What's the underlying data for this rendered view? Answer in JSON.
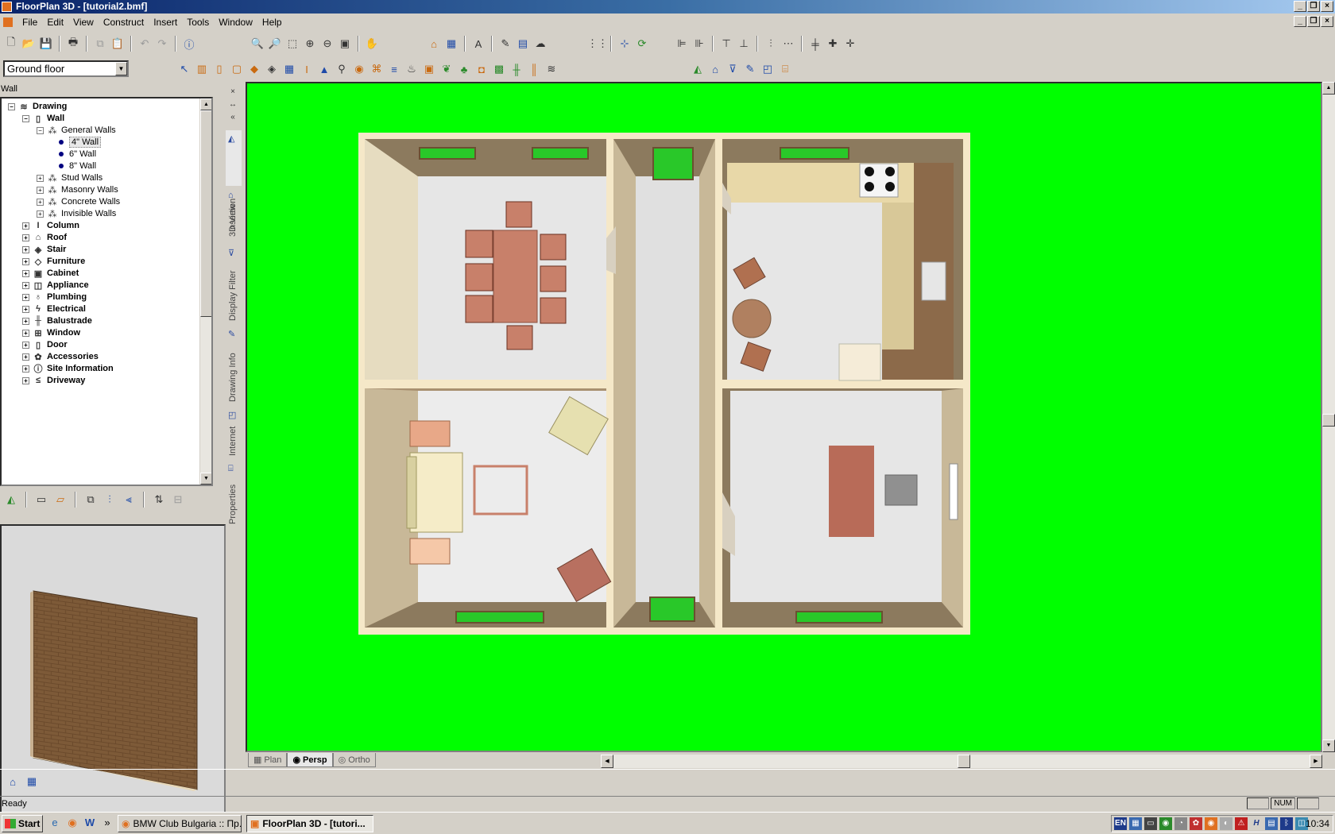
{
  "app": {
    "title": "FloorPlan 3D - [tutorial2.bmf]",
    "window_buttons": [
      "_",
      "❐",
      "×"
    ]
  },
  "menu": [
    "File",
    "Edit",
    "View",
    "Construct",
    "Insert",
    "Tools",
    "Window",
    "Help"
  ],
  "floor_select": {
    "value": "Ground floor"
  },
  "panel": {
    "title": "Wall",
    "tree": [
      {
        "label": "Drawing",
        "level": 0,
        "expander": "−",
        "bold": true,
        "icon": "≋"
      },
      {
        "label": "Wall",
        "level": 1,
        "expander": "−",
        "bold": true,
        "icon": "▯"
      },
      {
        "label": "General Walls",
        "level": 2,
        "expander": "−",
        "bold": false,
        "icon": "⁂"
      },
      {
        "label": "4\" Wall",
        "level": 3,
        "bullet": true,
        "selected": true
      },
      {
        "label": "6\" Wall",
        "level": 3,
        "bullet": true
      },
      {
        "label": "8\" Wall",
        "level": 3,
        "bullet": true
      },
      {
        "label": "Stud Walls",
        "level": 2,
        "expander": "+",
        "icon": "⁂"
      },
      {
        "label": "Masonry Walls",
        "level": 2,
        "expander": "+",
        "icon": "⁂"
      },
      {
        "label": "Concrete Walls",
        "level": 2,
        "expander": "+",
        "icon": "⁂"
      },
      {
        "label": "Invisible Walls",
        "level": 2,
        "expander": "+",
        "icon": "⁂"
      },
      {
        "label": "Column",
        "level": 1,
        "expander": "+",
        "bold": true,
        "icon": "I"
      },
      {
        "label": "Roof",
        "level": 1,
        "expander": "+",
        "bold": true,
        "icon": "⌂"
      },
      {
        "label": "Stair",
        "level": 1,
        "expander": "+",
        "bold": true,
        "icon": "◈"
      },
      {
        "label": "Furniture",
        "level": 1,
        "expander": "+",
        "bold": true,
        "icon": "◇"
      },
      {
        "label": "Cabinet",
        "level": 1,
        "expander": "+",
        "bold": true,
        "icon": "▣"
      },
      {
        "label": "Appliance",
        "level": 1,
        "expander": "+",
        "bold": true,
        "icon": "◫"
      },
      {
        "label": "Plumbing",
        "level": 1,
        "expander": "+",
        "bold": true,
        "icon": "♁"
      },
      {
        "label": "Electrical",
        "level": 1,
        "expander": "+",
        "bold": true,
        "icon": "ϟ"
      },
      {
        "label": "Balustrade",
        "level": 1,
        "expander": "+",
        "bold": true,
        "icon": "╫"
      },
      {
        "label": "Window",
        "level": 1,
        "expander": "+",
        "bold": true,
        "icon": "⊞"
      },
      {
        "label": "Door",
        "level": 1,
        "expander": "+",
        "bold": true,
        "icon": "▯"
      },
      {
        "label": "Accessories",
        "level": 1,
        "expander": "+",
        "bold": true,
        "icon": "✿"
      },
      {
        "label": "Site Information",
        "level": 1,
        "expander": "+",
        "bold": true,
        "icon": "ⓘ"
      },
      {
        "label": "Driveway",
        "level": 1,
        "expander": "+",
        "bold": true,
        "icon": "≤"
      }
    ]
  },
  "vertical_tabs": [
    "Insertion",
    "3D View",
    "Display Filter",
    "Drawing Info",
    "Internet",
    "Properties"
  ],
  "view_tabs": [
    {
      "label": "Plan",
      "active": false
    },
    {
      "label": "Persp",
      "active": true
    },
    {
      "label": "Ortho",
      "active": false
    }
  ],
  "status": {
    "text": "Ready",
    "num": "NUM"
  },
  "taskbar": {
    "start": "Start",
    "tasks": [
      {
        "label": "BMW Club Bulgaria :: Пр...",
        "active": false
      },
      {
        "label": "FloorPlan 3D - [tutori...",
        "active": true
      }
    ],
    "chevron": "»",
    "clock": "10:34",
    "lang": "EN"
  },
  "colors": {
    "viewport_bg": "#00ff00",
    "floor": "#e6e6e6",
    "wall_top": "#f5e8c8",
    "wall_side": "#8c7a5e",
    "furniture": "#c8806a",
    "window_glass": "#29c829"
  }
}
